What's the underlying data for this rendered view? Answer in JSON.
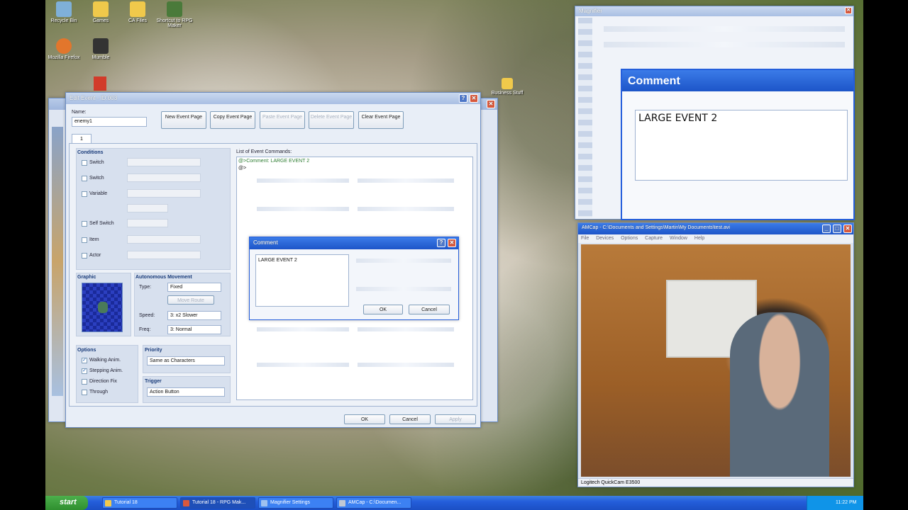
{
  "desktop": {
    "icons": [
      {
        "label": "Recycle Bin",
        "color": "#7fb0d8"
      },
      {
        "label": "Games",
        "color": "#f0c94b"
      },
      {
        "label": "CA Files",
        "color": "#f0c94b"
      },
      {
        "label": "Shortcut to RPG Maker",
        "color": "#4a7a3a"
      },
      {
        "label": "Mozilla Firefox",
        "color": "#e2762c"
      },
      {
        "label": "Mumble",
        "color": "#333333"
      },
      {
        "label": "Business Stuff",
        "color": "#f0c94b"
      }
    ]
  },
  "edit_event": {
    "title": "Edit Event - ID:003",
    "name_label": "Name:",
    "name_value": "enemy1",
    "buttons": {
      "new_page": "New Event Page",
      "copy_page": "Copy Event Page",
      "paste_page": "Paste Event Page",
      "delete_page": "Delete Event Page",
      "clear_page": "Clear Event Page"
    },
    "page_tab": "1",
    "conditions": {
      "heading": "Conditions",
      "items": [
        "Switch",
        "Switch",
        "Variable",
        "Self Switch",
        "Item",
        "Actor"
      ]
    },
    "graphic_heading": "Graphic",
    "autonomous": {
      "heading": "Autonomous Movement",
      "type_label": "Type:",
      "type_value": "Fixed",
      "move_route": "Move Route",
      "speed_label": "Speed:",
      "speed_value": "3: x2 Slower",
      "freq_label": "Freq:",
      "freq_value": "3: Normal"
    },
    "options": {
      "heading": "Options",
      "items": [
        {
          "label": "Walking Anim.",
          "checked": true
        },
        {
          "label": "Stepping Anim.",
          "checked": true
        },
        {
          "label": "Direction Fix",
          "checked": false
        },
        {
          "label": "Through",
          "checked": false
        }
      ]
    },
    "priority": {
      "heading": "Priority",
      "value": "Same as Characters"
    },
    "trigger": {
      "heading": "Trigger",
      "value": "Action Button"
    },
    "commands": {
      "heading": "List of Event Commands:",
      "lines": [
        "@>Comment: LARGE EVENT 2",
        "@>"
      ]
    },
    "footer": {
      "ok": "OK",
      "cancel": "Cancel",
      "apply": "Apply"
    }
  },
  "comment_dialog": {
    "title": "Comment",
    "text": "LARGE EVENT 2",
    "ok": "OK",
    "cancel": "Cancel"
  },
  "magnifier": {
    "title": "Magnifier",
    "zoom_title": "Comment",
    "zoom_text": "LARGE EVENT 2"
  },
  "amcap": {
    "title": "AMCap - C:\\Documents and Settings\\Martin\\My Documents\\test.avi",
    "menu": [
      "File",
      "Devices",
      "Options",
      "Capture",
      "Window",
      "Help"
    ],
    "status": "Logitech QuickCam E3500"
  },
  "taskbar": {
    "start": "start",
    "tasks": [
      "Tutorial 18",
      "Tutorial 18 - RPG Mak...",
      "Magnifier Settings",
      "AMCap - C:\\Documen..."
    ],
    "clock": "11:22 PM"
  },
  "colors": {
    "accent": "#245edb",
    "window_border": "#6e8fc4",
    "comment_green": "#2e7d32"
  }
}
